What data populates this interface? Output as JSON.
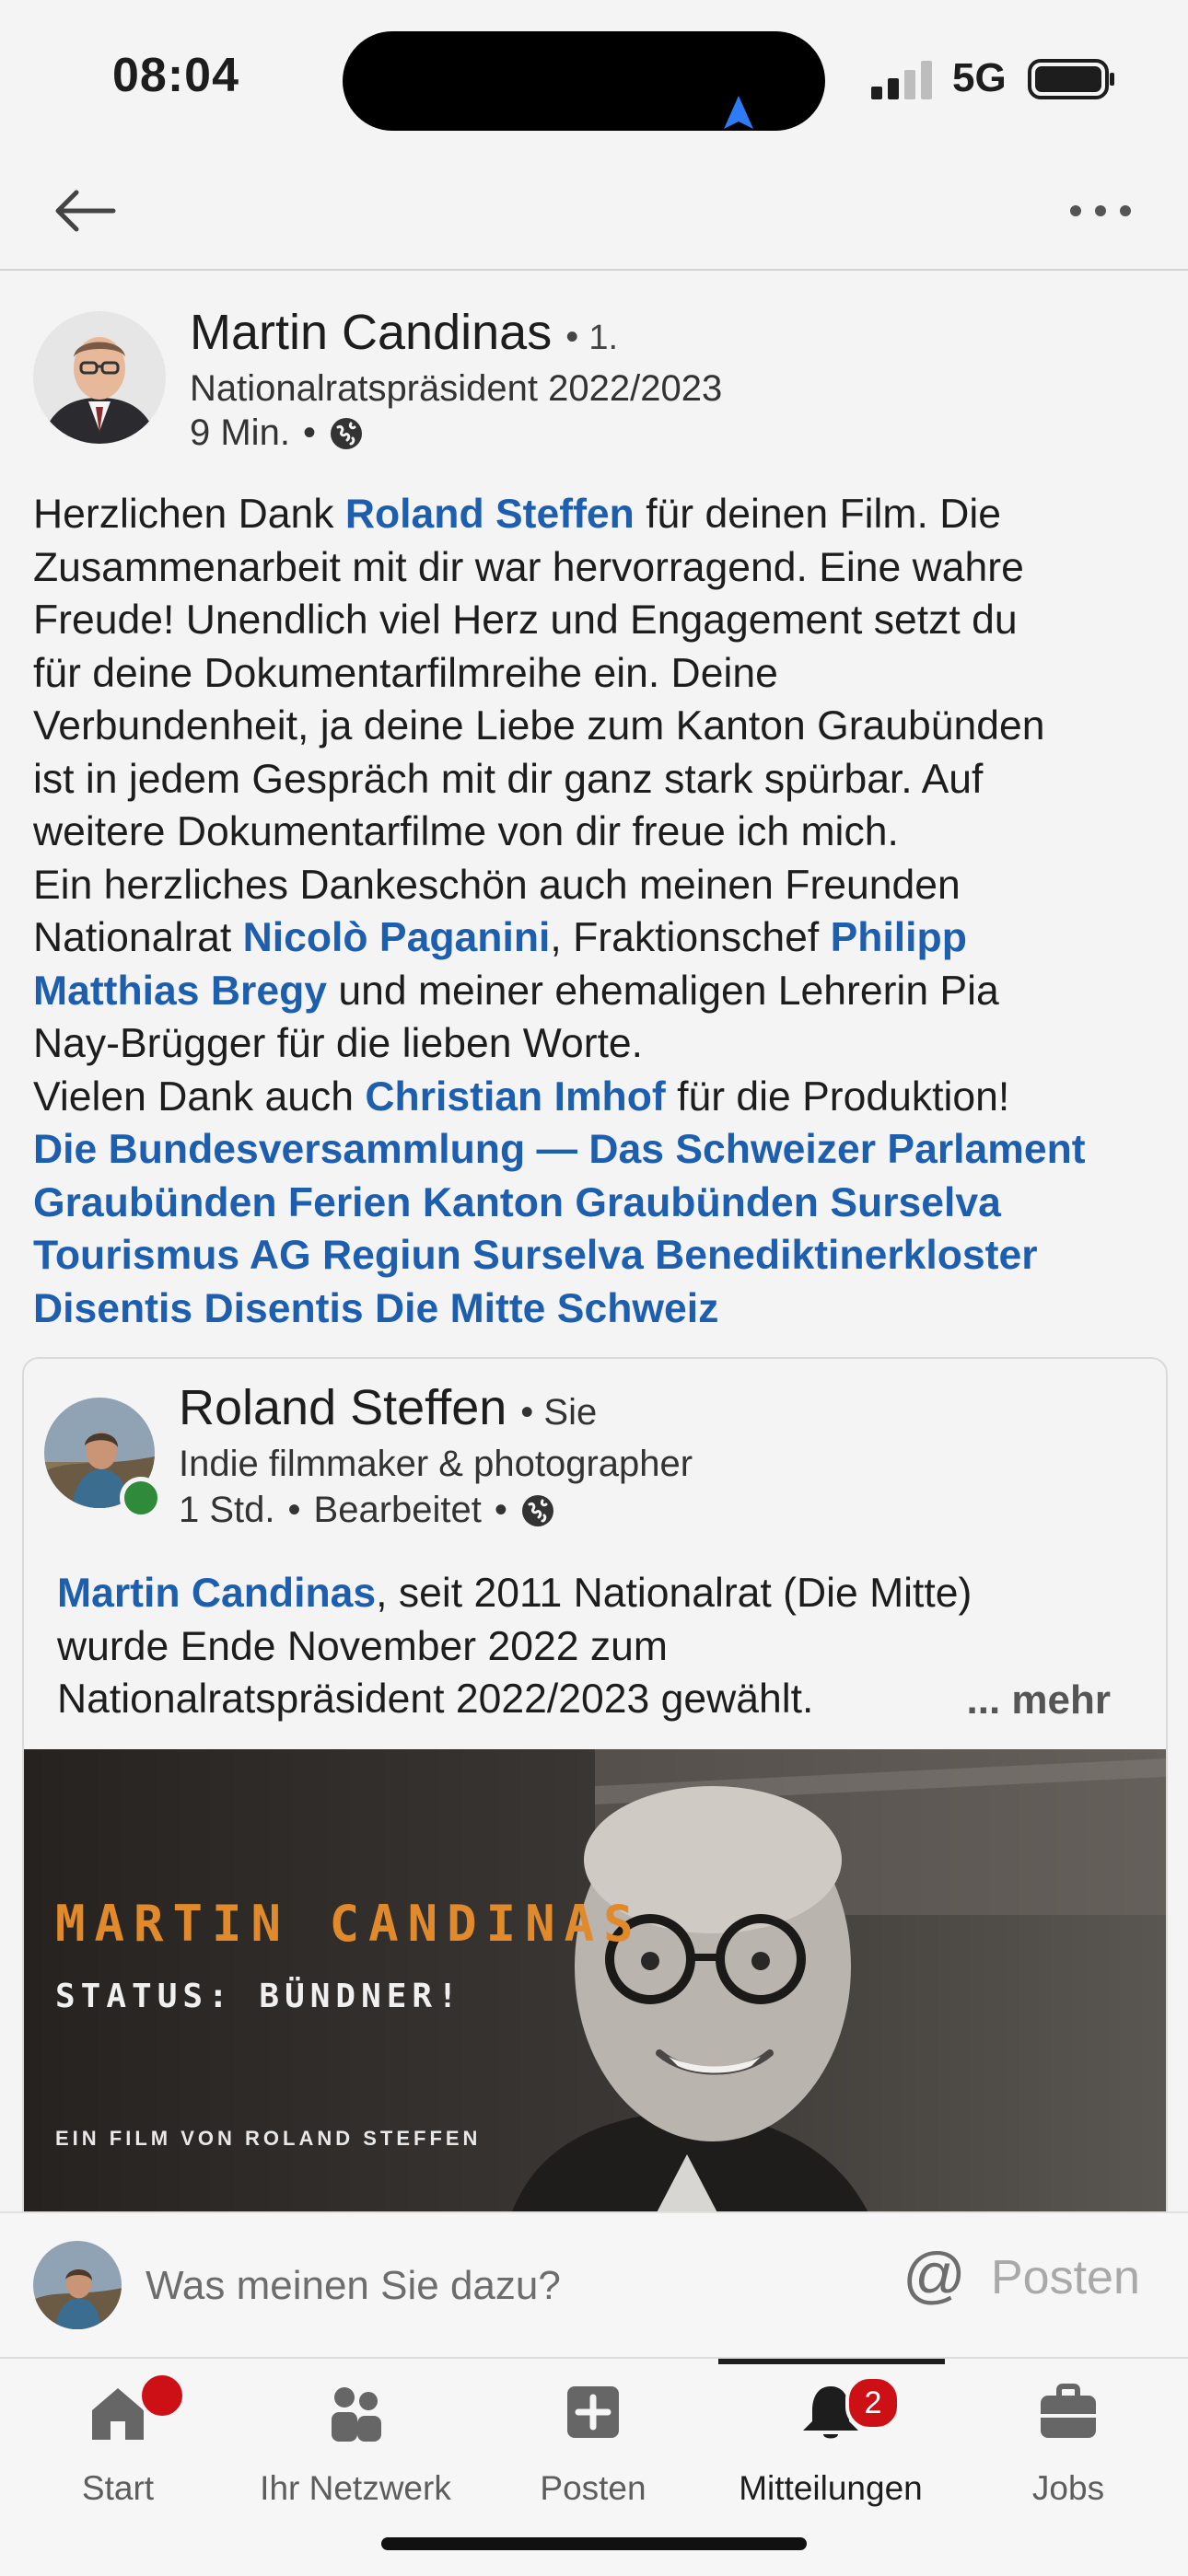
{
  "status_bar": {
    "time": "08:04",
    "network": "5G"
  },
  "post": {
    "author_name": "Martin Candinas",
    "degree": "1.",
    "author_title": "Nationalratspräsident 2022/2023",
    "time_ago": "9 Min.",
    "text_lines": [
      [
        {
          "t": "Herzlichen Dank "
        },
        {
          "t": "Roland Steffen",
          "link": true
        },
        {
          "t": " für deinen Film. Die"
        }
      ],
      [
        {
          "t": "Zusammenarbeit mit dir war hervorragend. Eine wahre"
        }
      ],
      [
        {
          "t": "Freude! Unendlich viel Herz und Engagement setzt du"
        }
      ],
      [
        {
          "t": "für deine Dokumentarfilmreihe ein. Deine"
        }
      ],
      [
        {
          "t": "Verbundenheit, ja deine Liebe zum Kanton Graubünden"
        }
      ],
      [
        {
          "t": "ist in jedem Gespräch mit dir ganz stark spürbar. Auf"
        }
      ],
      [
        {
          "t": "weitere Dokumentarfilme von dir freue ich mich."
        }
      ],
      [
        {
          "t": "Ein herzliches Dankeschön auch meinen Freunden"
        }
      ],
      [
        {
          "t": "Nationalrat "
        },
        {
          "t": "Nicolò Paganini",
          "link": true
        },
        {
          "t": ", Fraktionschef "
        },
        {
          "t": "Philipp",
          "link": true
        }
      ],
      [
        {
          "t": "Matthias Bregy",
          "link": true
        },
        {
          "t": " und meiner ehemaligen Lehrerin Pia"
        }
      ],
      [
        {
          "t": "Nay-Brügger für die lieben Worte."
        }
      ],
      [
        {
          "t": "Vielen Dank auch "
        },
        {
          "t": "Christian Imhof",
          "link": true
        },
        {
          "t": " für die Produktion!"
        }
      ],
      [
        {
          "t": "Die Bundesversammlung — Das Schweizer Parlament",
          "link": true
        }
      ],
      [
        {
          "t": "Graubünden Ferien",
          "link": true
        },
        {
          "t": " "
        },
        {
          "t": "Kanton Graubünden",
          "link": true
        },
        {
          "t": " "
        },
        {
          "t": "Surselva",
          "link": true
        }
      ],
      [
        {
          "t": "Tourismus AG",
          "link": true
        },
        {
          "t": " "
        },
        {
          "t": "Regiun Surselva",
          "link": true
        },
        {
          "t": " "
        },
        {
          "t": "Benediktinerkloster",
          "link": true
        }
      ],
      [
        {
          "t": "Disentis",
          "link": true
        },
        {
          "t": " "
        },
        {
          "t": "Disentis",
          "link": true
        },
        {
          "t": " "
        },
        {
          "t": "Die Mitte Schweiz",
          "link": true
        }
      ]
    ]
  },
  "shared": {
    "author_name": "Roland Steffen",
    "relation": "Sie",
    "author_title": "Indie filmmaker & photographer",
    "time_ago": "1 Std.",
    "edited": "Bearbeitet",
    "text_lines": [
      [
        {
          "t": "Martin Candinas",
          "link": true
        },
        {
          "t": ", seit 2011 Nationalrat (Die Mitte)"
        }
      ],
      [
        {
          "t": "wurde Ende November 2022 zum"
        }
      ],
      [
        {
          "t": "Nationalratspräsident 2022/2023 gewählt."
        }
      ]
    ],
    "more_label": "... mehr",
    "image": {
      "title": "MARTIN CANDINAS",
      "subtitle": "STATUS: BÜNDNER!",
      "credit": "EIN FILM VON ROLAND STEFFEN"
    }
  },
  "comment": {
    "placeholder": "Was meinen Sie dazu?",
    "at_label": "@",
    "post_label": "Posten"
  },
  "nav": {
    "items": [
      {
        "label": "Start",
        "icon": "home-icon"
      },
      {
        "label": "Ihr Netzwerk",
        "icon": "network-icon"
      },
      {
        "label": "Posten",
        "icon": "post-plus-icon"
      },
      {
        "label": "Mitteilungen",
        "icon": "bell-icon",
        "active": true
      },
      {
        "label": "Jobs",
        "icon": "briefcase-icon"
      }
    ],
    "home_badge": "",
    "notifications_badge": "2"
  },
  "colors": {
    "link": "#1d5fae",
    "badge": "#cc1016",
    "online": "#2f8a3a",
    "film_title": "#e08a2c"
  }
}
